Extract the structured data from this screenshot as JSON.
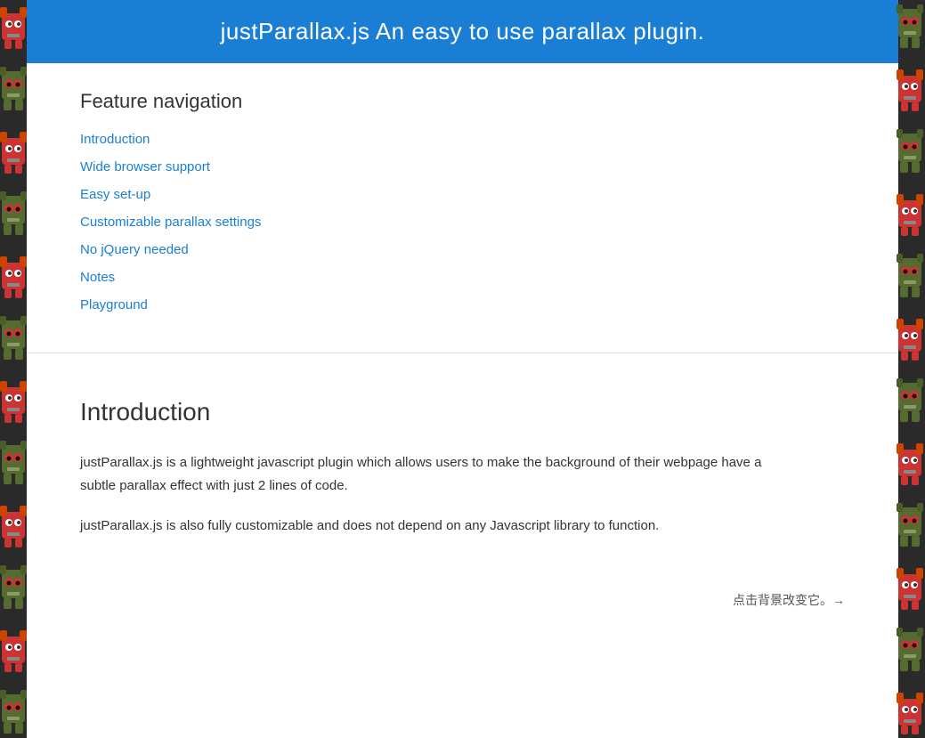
{
  "header": {
    "title": "justParallax.js",
    "subtitle": "  An easy to use parallax plugin."
  },
  "nav": {
    "heading": "Feature navigation",
    "links": [
      {
        "label": "Introduction",
        "href": "#introduction"
      },
      {
        "label": "Wide browser support",
        "href": "#wide-browser-support"
      },
      {
        "label": "Easy set-up",
        "href": "#easy-setup"
      },
      {
        "label": "Customizable parallax settings",
        "href": "#customizable"
      },
      {
        "label": "No jQuery needed",
        "href": "#no-jquery"
      },
      {
        "label": "Notes",
        "href": "#notes"
      },
      {
        "label": "Playground",
        "href": "#playground"
      }
    ]
  },
  "intro": {
    "heading": "Introduction",
    "paragraph1": "justParallax.js is a lightweight javascript plugin which allows users to make the background of their webpage have a subtle parallax effect with just 2 lines of code.",
    "paragraph2": "justParallax.js is also fully customizable and does not depend on any Javascript library to function."
  },
  "footer_link": {
    "text": "点击背景改变它。→"
  },
  "colors": {
    "accent": "#1a7fd4",
    "header_bg": "#1a7fd4",
    "body_bg": "#2a2a2a",
    "text_main": "#333333",
    "link_color": "#1a7fd4"
  }
}
